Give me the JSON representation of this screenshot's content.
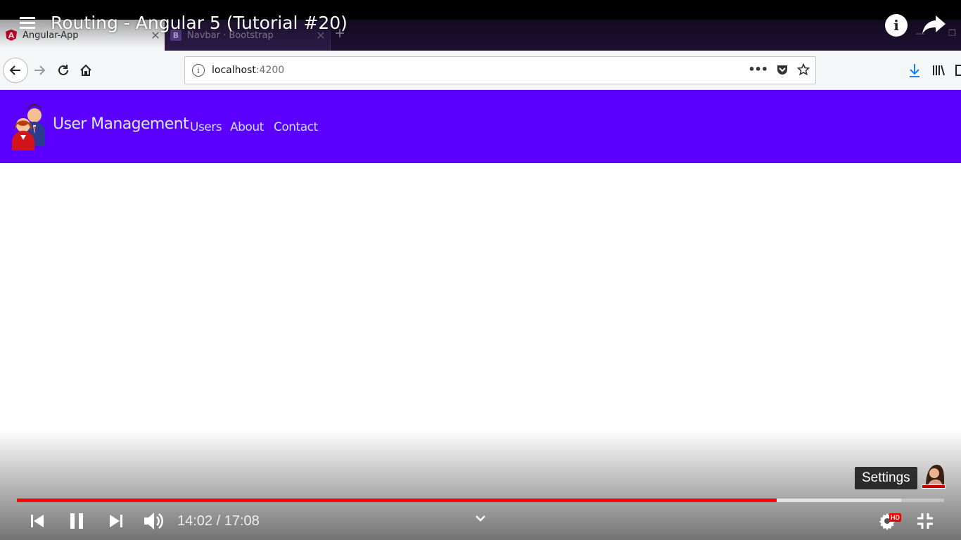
{
  "browser": {
    "tabs": [
      {
        "title": "Angular-App",
        "favicon": "A"
      },
      {
        "title": "Navbar · Bootstrap",
        "favicon": "B"
      }
    ],
    "new_tab_icon": "plus-icon",
    "url_host": "localhost",
    "url_port": ":4200"
  },
  "app": {
    "brand": "User Management",
    "nav": {
      "users": "Users",
      "about": "About",
      "contact": "Contact"
    },
    "colors": {
      "navbar": "#5b00ff"
    }
  },
  "video": {
    "title": "Routing - Angular 5 (Tutorial #20)",
    "current_time": "14:02",
    "duration": "17:08",
    "played_fraction": 0.8195,
    "buffered_fraction": 0.954,
    "tooltip": "Settings",
    "quality_badge": "HD",
    "colors": {
      "progress": "#ff0000"
    }
  }
}
